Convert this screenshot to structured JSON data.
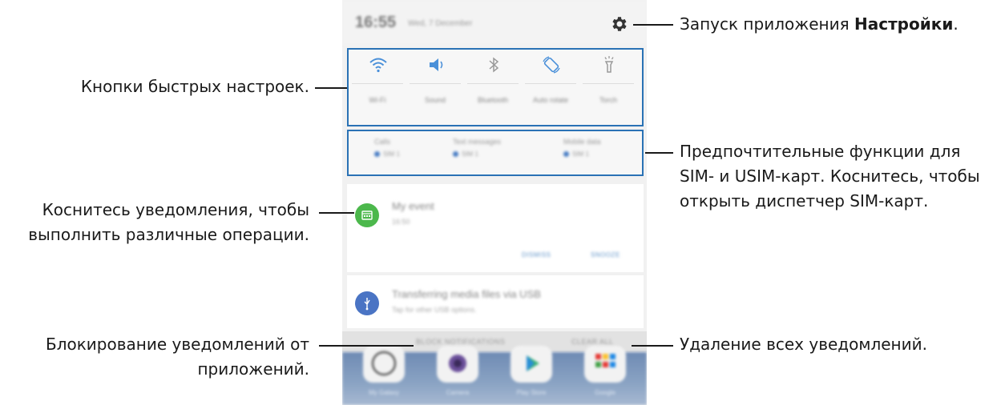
{
  "phone": {
    "status_bar": {
      "time": "16:55",
      "date": "Wed, 7 December"
    },
    "quick_settings": [
      {
        "label": "Wi-Fi",
        "icon": "wifi-icon",
        "active": true
      },
      {
        "label": "Sound",
        "icon": "sound-icon",
        "active": true
      },
      {
        "label": "Bluetooth",
        "icon": "bluetooth-icon",
        "active": false
      },
      {
        "label": "Auto rotate",
        "icon": "auto-rotate-icon",
        "active": true
      },
      {
        "label": "Torch",
        "icon": "torch-icon",
        "active": false
      }
    ],
    "sim_preferences": [
      {
        "title": "Calls",
        "value": "SIM 1"
      },
      {
        "title": "Text messages",
        "value": "SIM 1"
      },
      {
        "title": "Mobile data",
        "value": "SIM 1"
      }
    ],
    "notifications": [
      {
        "title": "My event",
        "subtitle": "16:50",
        "icon": "calendar-icon",
        "actions": [
          "DISMISS",
          "SNOOZE"
        ]
      },
      {
        "title": "Transferring media files via USB",
        "subtitle": "Tap for other USB options.",
        "icon": "usb-icon",
        "actions": []
      }
    ],
    "bottom_bar": {
      "block": "BLOCK NOTIFICATIONS",
      "clear": "CLEAR ALL"
    },
    "home_apps": [
      "My Galaxy",
      "Camera",
      "Play Store",
      "Google"
    ]
  },
  "callouts": {
    "settings_prefix": "Запуск приложения ",
    "settings_bold": "Настройки",
    "settings_suffix": ".",
    "quick_buttons": "Кнопки быстрых настроек.",
    "sim_line1": "Предпочтительные функции для",
    "sim_line2": "SIM- и USIM-карт. Коснитесь, чтобы",
    "sim_line3": "открыть диспетчер SIM-карт.",
    "notif_line1": "Коснитесь уведомления, чтобы",
    "notif_line2": "выполнить различные операции.",
    "block_line1": "Блокирование уведомлений от",
    "block_line2": "приложений.",
    "clear_all": "Удаление всех уведомлений."
  },
  "colors": {
    "highlight_border": "#2a72b5",
    "qs_active": "#4a90d9",
    "qs_inactive": "#9a9a9a",
    "calendar_green": "#4cb84c",
    "usb_blue": "#4a74c4"
  }
}
